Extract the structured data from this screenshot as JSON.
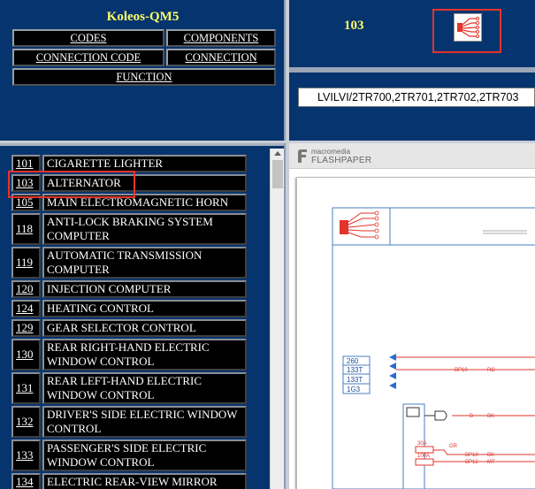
{
  "header": {
    "title": "Koleos-QM5",
    "buttons": {
      "codes": "CODES",
      "components": "COMPONENTS",
      "connection_code": "CONNECTION CODE",
      "connection": "CONNECTION",
      "function": "FUNCTION"
    }
  },
  "selected": {
    "code": "103",
    "connection_string": "LVILVI/2TR700,2TR701,2TR702,2TR703"
  },
  "flashpaper": {
    "brand_small": "macromedia",
    "brand_big": "FLASHPAPER"
  },
  "diagram": {
    "connectors": [
      "260",
      "133T",
      "133T",
      "1G3"
    ],
    "wire_labels": [
      "BP10",
      "RC",
      "B",
      "BK",
      "GR",
      "BP10",
      "BP12",
      "BK",
      "MT"
    ],
    "fuses": [
      "30A",
      "100A"
    ]
  },
  "components": [
    {
      "num": "101",
      "label": "CIGARETTE LIGHTER"
    },
    {
      "num": "103",
      "label": "ALTERNATOR"
    },
    {
      "num": "105",
      "label": "MAIN ELECTROMAGNETIC HORN"
    },
    {
      "num": "118",
      "label": "ANTI-LOCK BRAKING SYSTEM COMPUTER"
    },
    {
      "num": "119",
      "label": "AUTOMATIC TRANSMISSION COMPUTER"
    },
    {
      "num": "120",
      "label": "INJECTION COMPUTER"
    },
    {
      "num": "124",
      "label": "HEATING CONTROL"
    },
    {
      "num": "129",
      "label": "GEAR SELECTOR CONTROL"
    },
    {
      "num": "130",
      "label": "REAR RIGHT-HAND ELECTRIC WINDOW CONTROL"
    },
    {
      "num": "131",
      "label": "REAR LEFT-HAND ELECTRIC WINDOW CONTROL"
    },
    {
      "num": "132",
      "label": "DRIVER'S SIDE ELECTRIC WINDOW CONTROL"
    },
    {
      "num": "133",
      "label": "PASSENGER'S SIDE ELECTRIC WINDOW CONTROL"
    },
    {
      "num": "134",
      "label": "ELECTRIC REAR-VIEW MIRROR"
    }
  ],
  "colors": {
    "panel": "#06346e",
    "title": "#ffff66",
    "highlight": "#e2342c"
  }
}
